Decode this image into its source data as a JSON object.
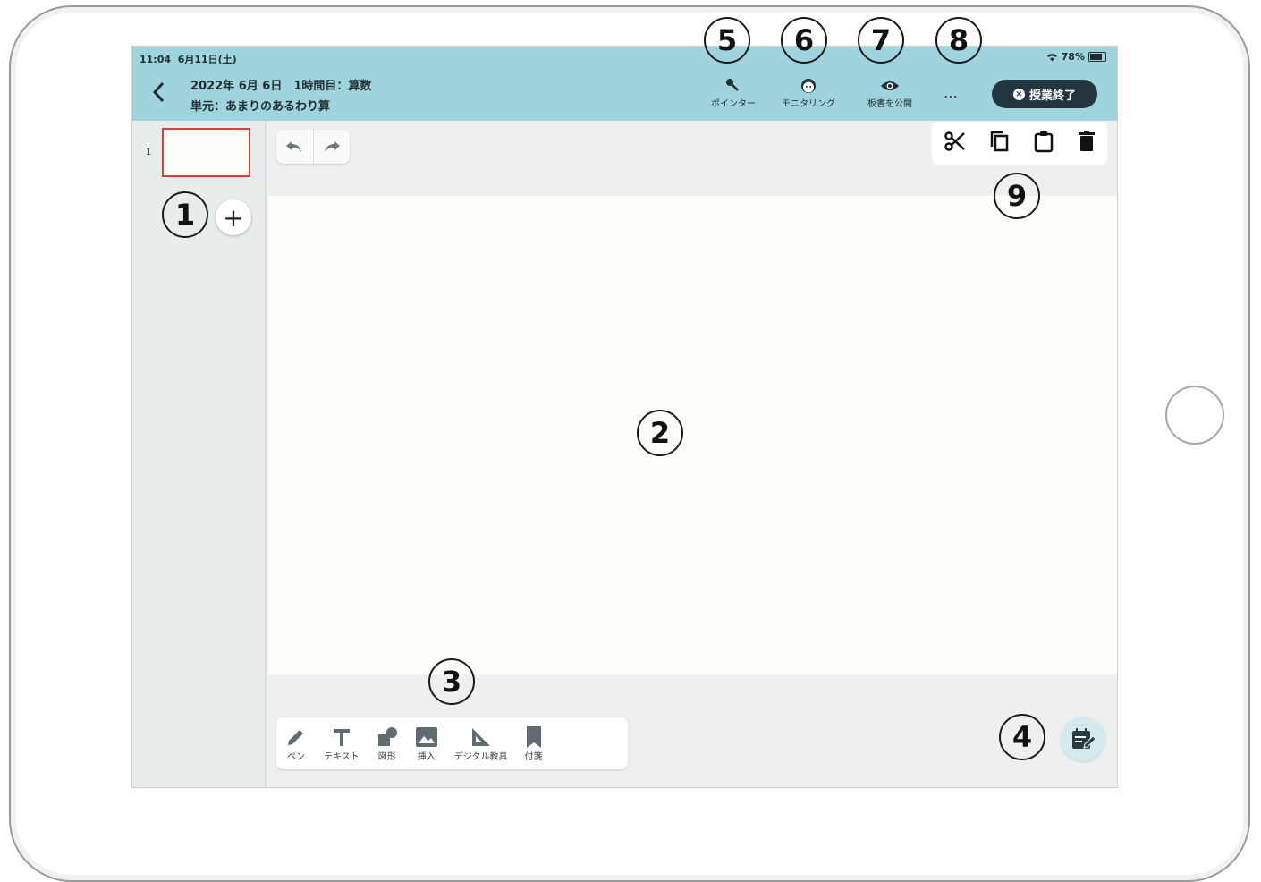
{
  "status_bar": {
    "time": "11:04",
    "date": "6月11日(土)",
    "battery": "78%"
  },
  "header": {
    "lesson_title": "2022年 6月 6日　1時間目：算数",
    "unit": "単元：あまりのあるわり算",
    "tools": [
      {
        "label": "ポインター",
        "icon": "pointer-icon"
      },
      {
        "label": "モニタリング",
        "icon": "monitoring-face-icon"
      },
      {
        "label": "板書を公開",
        "icon": "eye-icon"
      }
    ],
    "more_label": "…",
    "end_class_label": "授業終了"
  },
  "sidebar": {
    "pages": [
      {
        "number": "1"
      }
    ],
    "add_label": "+"
  },
  "edit_toolbar": {
    "items": [
      "scissors-icon",
      "copy-icon",
      "paste-icon",
      "trash-icon"
    ]
  },
  "bottom_toolbar": {
    "items": [
      {
        "label": "ペン",
        "icon": "pen-icon"
      },
      {
        "label": "テキスト",
        "icon": "text-icon"
      },
      {
        "label": "図形",
        "icon": "shape-icon"
      },
      {
        "label": "挿入",
        "icon": "image-icon"
      },
      {
        "label": "デジタル教具",
        "icon": "ruler-triangle-icon"
      },
      {
        "label": "付箋",
        "icon": "bookmark-icon"
      }
    ]
  },
  "markers": [
    "1",
    "2",
    "3",
    "4",
    "5",
    "6",
    "7",
    "8",
    "9"
  ],
  "colors": {
    "header": "#9fd4de",
    "end_button": "#233640",
    "thumb_border": "#e03a3a",
    "canvas": "#fffdf8"
  }
}
